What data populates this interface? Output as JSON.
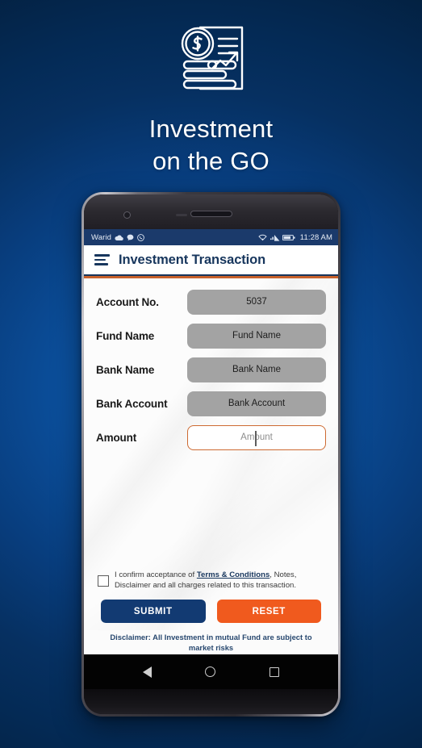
{
  "hero": {
    "icon_name": "investment-document-icon",
    "title_line1": "Investment",
    "title_line2": "on the GO"
  },
  "statusbar": {
    "carrier": "Warid",
    "icons": [
      "cloud-icon",
      "chat-icon",
      "whatsapp-icon",
      "wifi-icon",
      "signal-icon",
      "battery-icon"
    ],
    "time": "11:28 AM"
  },
  "app_header": {
    "menu_icon": "hamburger-menu-icon",
    "title": "Investment Transaction"
  },
  "form": {
    "fields": [
      {
        "label": "Account No.",
        "value": "5037",
        "focused": false
      },
      {
        "label": "Fund Name",
        "value": "Fund Name",
        "focused": false
      },
      {
        "label": "Bank Name",
        "value": "Bank Name",
        "focused": false
      },
      {
        "label": "Bank Account",
        "value": "Bank Account",
        "focused": false
      },
      {
        "label": "Amount",
        "value": "Amount",
        "focused": true
      }
    ]
  },
  "terms": {
    "checked": false,
    "text_before": "I confirm acceptance of ",
    "link_text": "Terms & Conditions",
    "text_after": ", Notes, Disclaimer and all charges related to this transaction."
  },
  "actions": {
    "submit_label": "SUBMIT",
    "reset_label": "RESET"
  },
  "disclaimer": {
    "text": "Disclaimer: All Investment in mutual Fund are subject to market risks"
  },
  "navbar": {
    "back": "back-icon",
    "home": "home-icon",
    "recents": "recents-icon"
  },
  "colors": {
    "brand_navy": "#17365d",
    "accent_orange": "#f05a1e",
    "focus_border": "#cd6a32",
    "field_gray": "#a3a3a3",
    "statusbar_navy": "#1b3a6b"
  }
}
